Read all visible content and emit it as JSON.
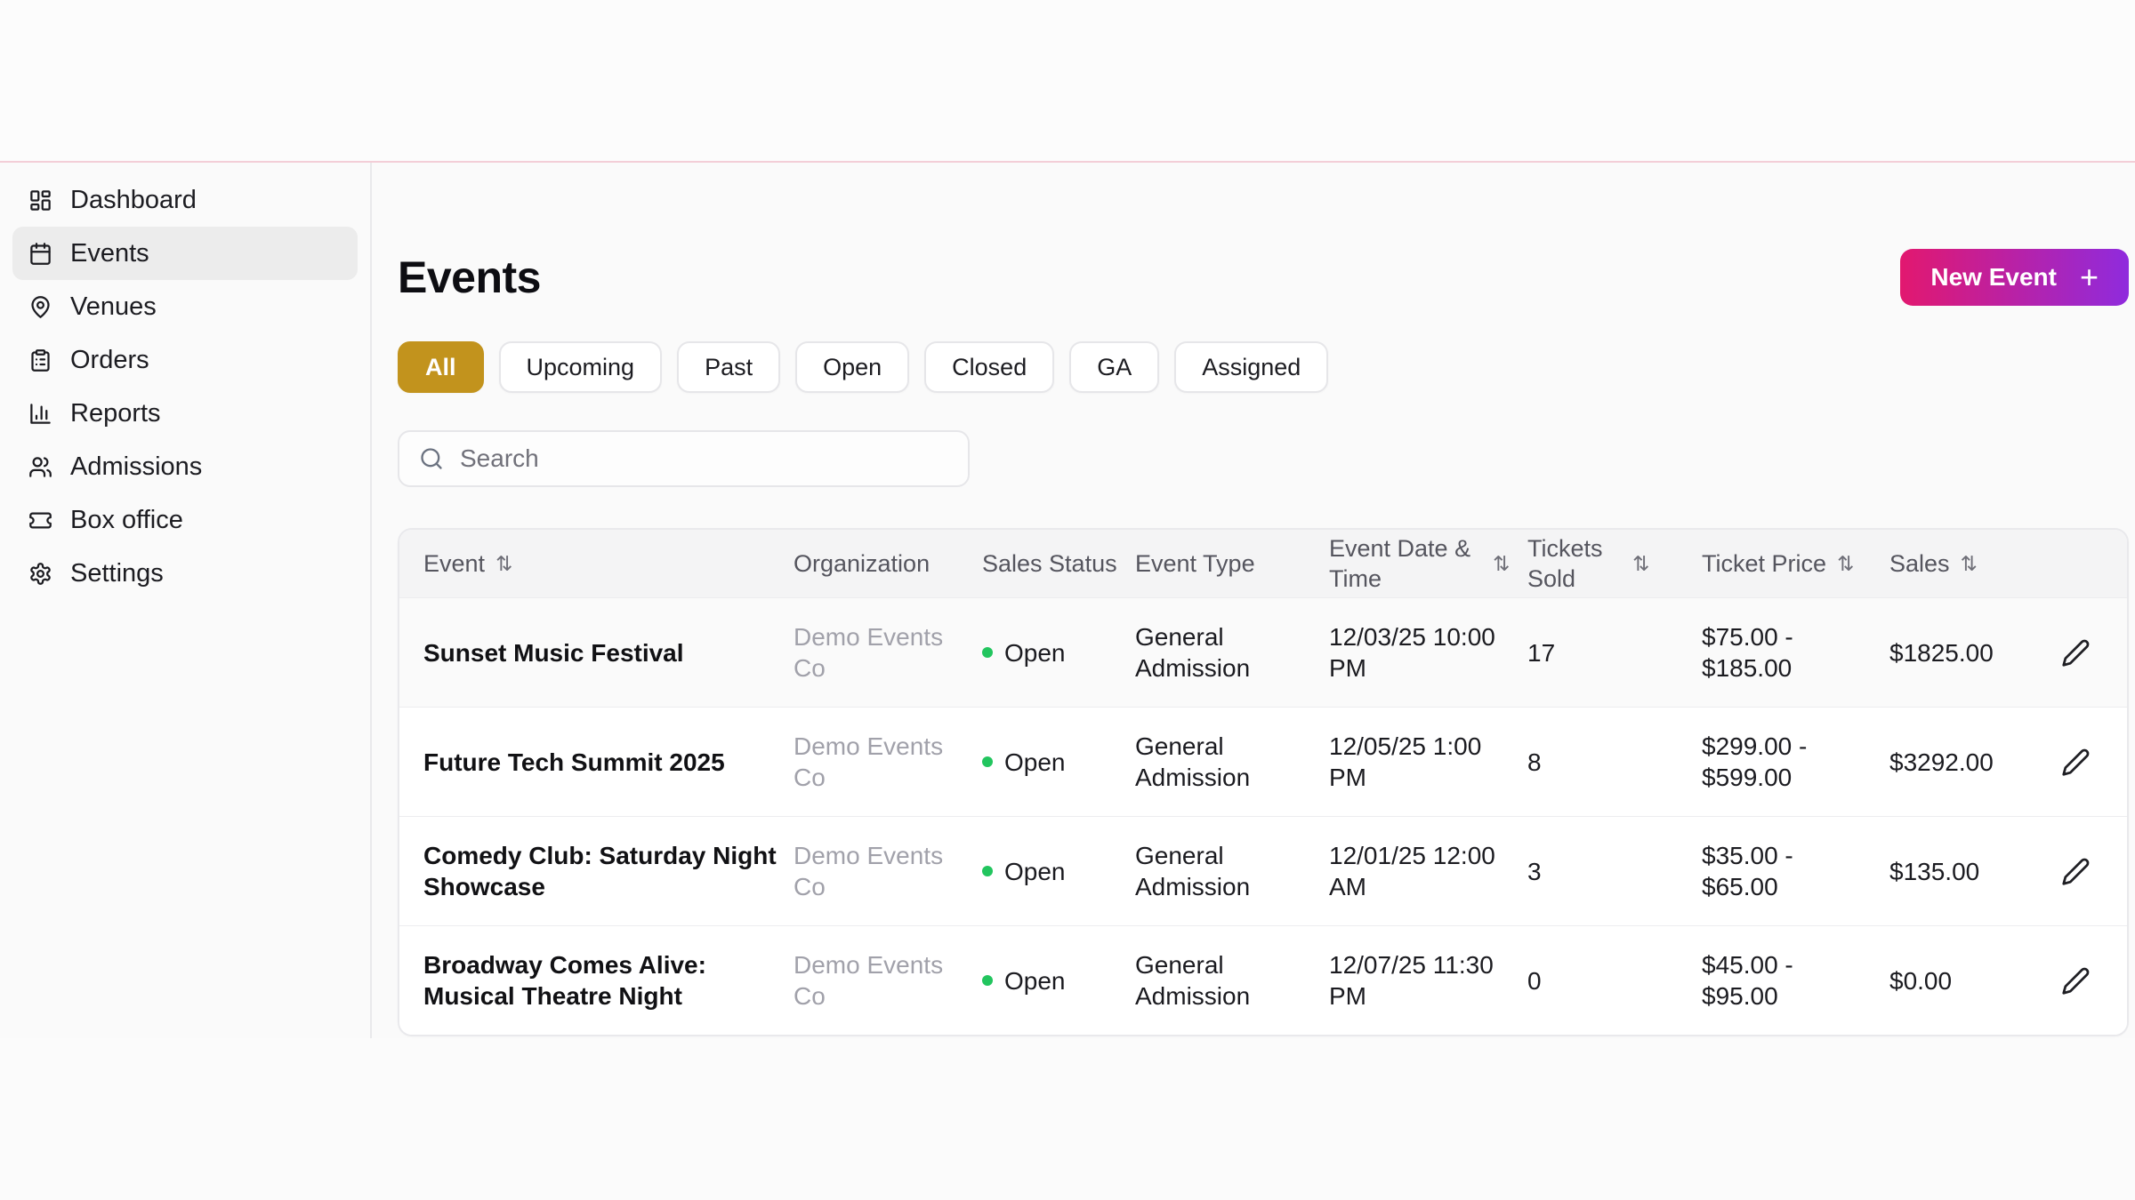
{
  "page": {
    "top_border_color": "#f3ced7",
    "background": "#fafafa"
  },
  "colors": {
    "accent_gold": "#c2931d",
    "new_event_gradient_from": "#e2186f",
    "new_event_gradient_to": "#8f2bdd",
    "status_open_dot": "#22c55e"
  },
  "icons": {
    "sort": "⇅",
    "plus": "+"
  },
  "sidebar": {
    "items": [
      {
        "label": "Dashboard"
      },
      {
        "label": "Events"
      },
      {
        "label": "Venues"
      },
      {
        "label": "Orders"
      },
      {
        "label": "Reports"
      },
      {
        "label": "Admissions"
      },
      {
        "label": "Box office"
      },
      {
        "label": "Settings"
      }
    ]
  },
  "header": {
    "title": "Events",
    "new_event_button": "New Event"
  },
  "filters": {
    "chips": [
      {
        "label": "All",
        "active": true
      },
      {
        "label": "Upcoming",
        "active": false
      },
      {
        "label": "Past",
        "active": false
      },
      {
        "label": "Open",
        "active": false
      },
      {
        "label": "Closed",
        "active": false
      },
      {
        "label": "GA",
        "active": false
      },
      {
        "label": "Assigned",
        "active": false
      }
    ]
  },
  "search": {
    "placeholder": "Search"
  },
  "table": {
    "columns": [
      {
        "label": "Event",
        "sortable": true
      },
      {
        "label": "Organization",
        "sortable": false
      },
      {
        "label": "Sales Status",
        "sortable": false
      },
      {
        "label": "Event Type",
        "sortable": false
      },
      {
        "label": "Event Date & Time",
        "sortable": true
      },
      {
        "label": "Tickets Sold",
        "sortable": true
      },
      {
        "label": "Ticket Price",
        "sortable": true
      },
      {
        "label": "Sales",
        "sortable": true
      }
    ],
    "rows": [
      {
        "event": "Sunset Music Festival",
        "organization": "Demo Events Co",
        "sales_status": "Open",
        "event_type": "General Admission",
        "datetime": "12/03/25 10:00 PM",
        "tickets_sold": "17",
        "ticket_price": "$75.00 - $185.00",
        "sales": "$1825.00"
      },
      {
        "event": "Future Tech Summit 2025",
        "organization": "Demo Events Co",
        "sales_status": "Open",
        "event_type": "General Admission",
        "datetime": "12/05/25 1:00 PM",
        "tickets_sold": "8",
        "ticket_price": "$299.00 - $599.00",
        "sales": "$3292.00"
      },
      {
        "event": "Comedy Club: Saturday Night Showcase",
        "organization": "Demo Events Co",
        "sales_status": "Open",
        "event_type": "General Admission",
        "datetime": "12/01/25 12:00 AM",
        "tickets_sold": "3",
        "ticket_price": "$35.00 - $65.00",
        "sales": "$135.00"
      },
      {
        "event": "Broadway Comes Alive: Musical Theatre Night",
        "organization": "Demo Events Co",
        "sales_status": "Open",
        "event_type": "General Admission",
        "datetime": "12/07/25 11:30 PM",
        "tickets_sold": "0",
        "ticket_price": "$45.00 - $95.00",
        "sales": "$0.00"
      }
    ]
  }
}
